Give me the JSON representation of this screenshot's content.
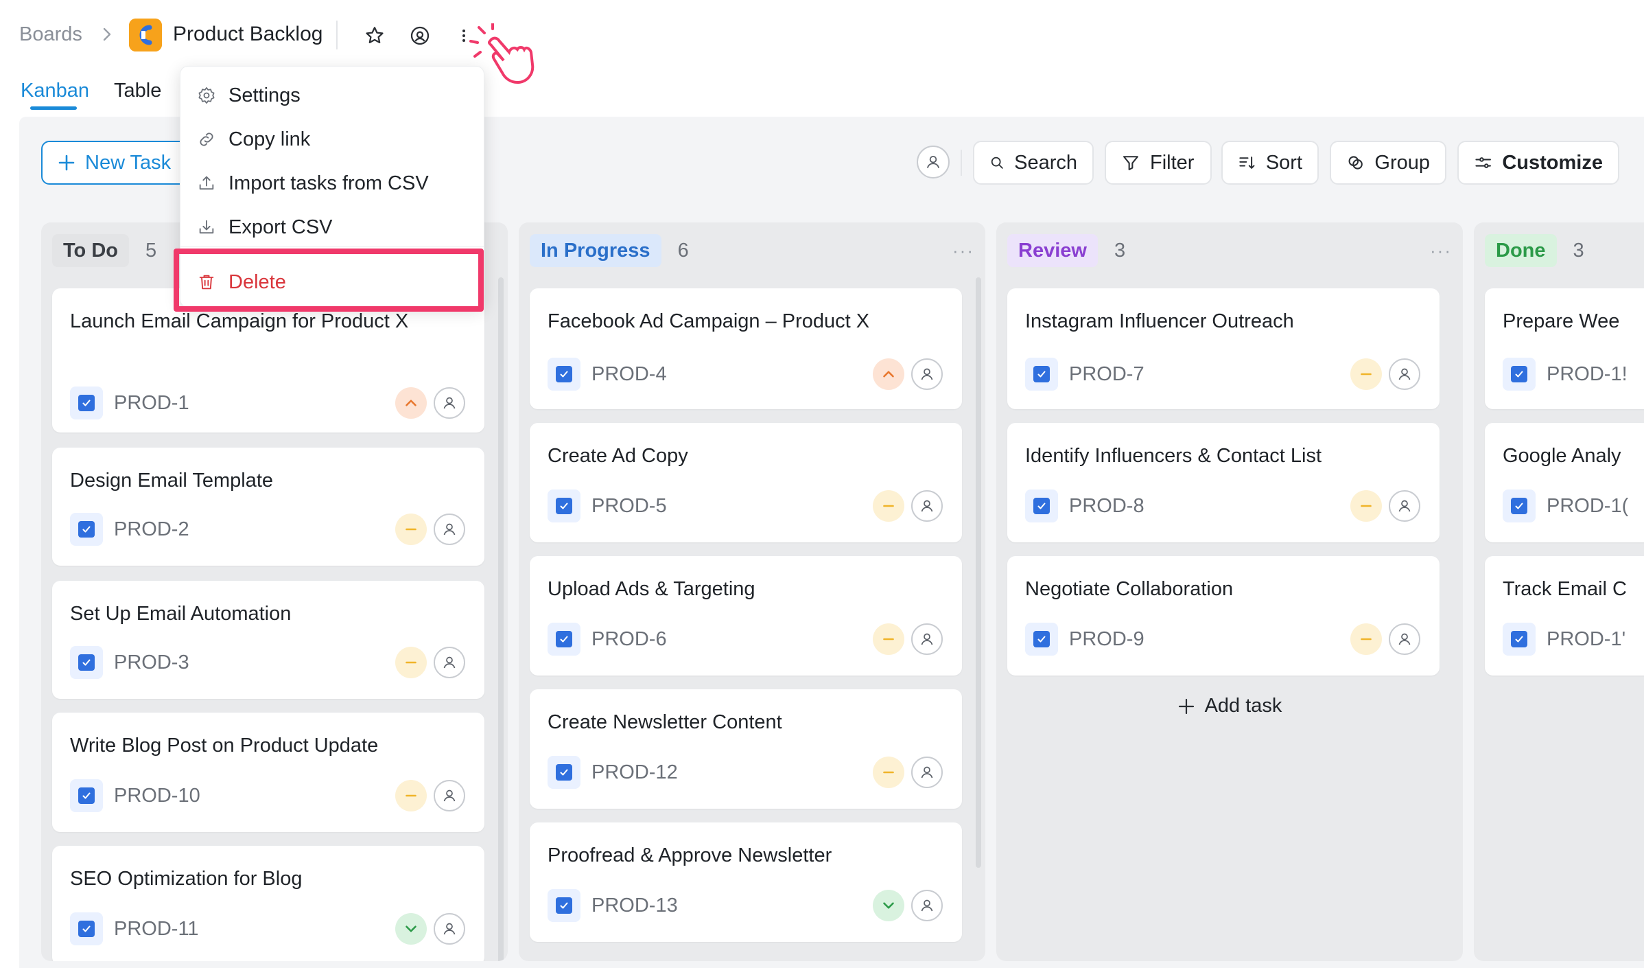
{
  "breadcrumb": {
    "root": "Boards",
    "board_title": "Product Backlog"
  },
  "header_icons": {
    "star": "star-icon",
    "watch": "watch-icon",
    "more": "more-vertical-icon"
  },
  "tabs": [
    {
      "label": "Kanban",
      "active": true
    },
    {
      "label": "Table",
      "active": false
    }
  ],
  "toolbar": {
    "new_task": "New Task",
    "search": "Search",
    "filter": "Filter",
    "sort": "Sort",
    "group": "Group",
    "customize": "Customize"
  },
  "menu": {
    "settings": "Settings",
    "copy_link": "Copy link",
    "import_csv": "Import tasks from CSV",
    "export_csv": "Export CSV",
    "delete": "Delete"
  },
  "colors": {
    "accent": "#1a8ad8",
    "todo_chip": "#e3e4e6",
    "inprogress_chip": "#dbe8fb",
    "inprogress_text": "#2a6fc9",
    "review_chip": "#ece3fb",
    "review_text": "#8a3fd1",
    "done_chip": "#d9f2df",
    "done_text": "#2b9a48",
    "delete_highlight": "#f0396a"
  },
  "columns": [
    {
      "name": "To Do",
      "count": "5",
      "cards": [
        {
          "title": "Launch Email Campaign for Product X",
          "id": "PROD-1",
          "priority": "high"
        },
        {
          "title": "Design Email Template",
          "id": "PROD-2",
          "priority": "medium"
        },
        {
          "title": "Set Up Email Automation",
          "id": "PROD-3",
          "priority": "medium"
        },
        {
          "title": "Write Blog Post on Product Update",
          "id": "PROD-10",
          "priority": "medium"
        },
        {
          "title": "SEO Optimization for Blog",
          "id": "PROD-11",
          "priority": "low"
        }
      ]
    },
    {
      "name": "In Progress",
      "count": "6",
      "cards": [
        {
          "title": "Facebook Ad Campaign – Product X",
          "id": "PROD-4",
          "priority": "high"
        },
        {
          "title": "Create Ad Copy",
          "id": "PROD-5",
          "priority": "medium"
        },
        {
          "title": "Upload Ads & Targeting",
          "id": "PROD-6",
          "priority": "medium"
        },
        {
          "title": "Create Newsletter Content",
          "id": "PROD-12",
          "priority": "medium"
        },
        {
          "title": "Proofread & Approve Newsletter",
          "id": "PROD-13",
          "priority": "low"
        }
      ]
    },
    {
      "name": "Review",
      "count": "3",
      "cards": [
        {
          "title": "Instagram Influencer Outreach",
          "id": "PROD-7",
          "priority": "medium"
        },
        {
          "title": "Identify Influencers & Contact List",
          "id": "PROD-8",
          "priority": "medium"
        },
        {
          "title": "Negotiate Collaboration",
          "id": "PROD-9",
          "priority": "medium"
        }
      ],
      "add_task": "Add task"
    },
    {
      "name": "Done",
      "count": "3",
      "cards": [
        {
          "title": "Prepare Wee",
          "id": "PROD-1!",
          "priority": ""
        },
        {
          "title": "Google Analy",
          "id": "PROD-1(",
          "priority": ""
        },
        {
          "title": "Track Email C",
          "id": "PROD-1'",
          "priority": ""
        }
      ]
    }
  ]
}
